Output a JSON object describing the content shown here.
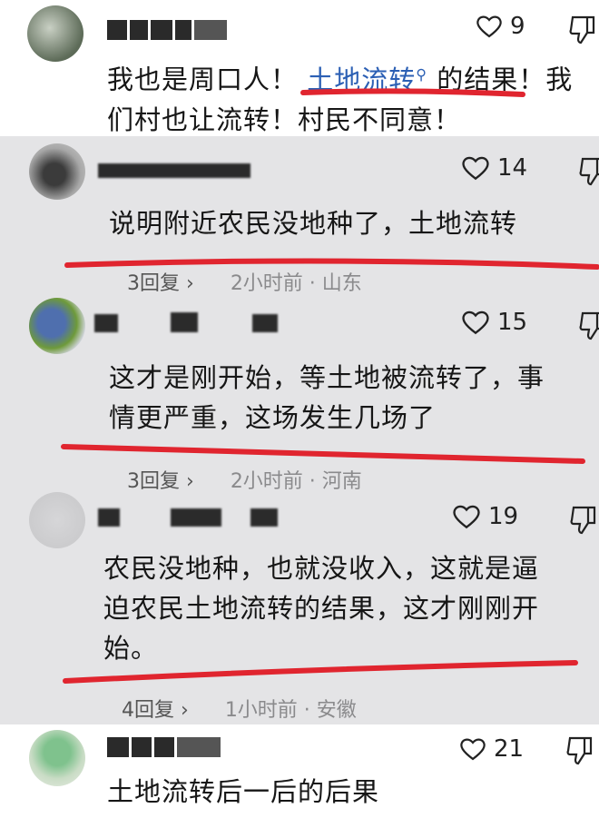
{
  "comments": [
    {
      "likes": "9",
      "text_before": "我也是周口人！",
      "link_text": "土地流转",
      "text_after": "的结果！我们村也让流转！村民不同意！"
    },
    {
      "likes": "14",
      "text": "说明附近农民没地种了，土地流转",
      "replies": "3回复",
      "chevron": "›",
      "time_location": "2小时前 · 山东"
    },
    {
      "likes": "15",
      "text_line1": "这才是刚开始，等土地被流转了，事",
      "text_line2": "情更严重，这场发生几场了",
      "replies": "3回复",
      "chevron": "›",
      "time_location": "2小时前 · 河南"
    },
    {
      "likes": "19",
      "text_line1": "农民没地种，也就没收入，这就是逼",
      "text_line2": "迫农民土地流转的结果，这才刚刚开",
      "text_line3": "始。",
      "replies": "4回复",
      "chevron": "›",
      "time_location": "1小时前 · 安徽"
    },
    {
      "likes": "21",
      "text": "土地流转后一后的后果"
    }
  ],
  "colors": {
    "highlight_line": "#e0252f",
    "link": "#2b5fb4",
    "screenshot_bg": "#e4e4e6"
  },
  "icons": {
    "like": "heart-outline-icon",
    "dislike": "thumb-down-outline-icon",
    "search": "search-icon"
  }
}
